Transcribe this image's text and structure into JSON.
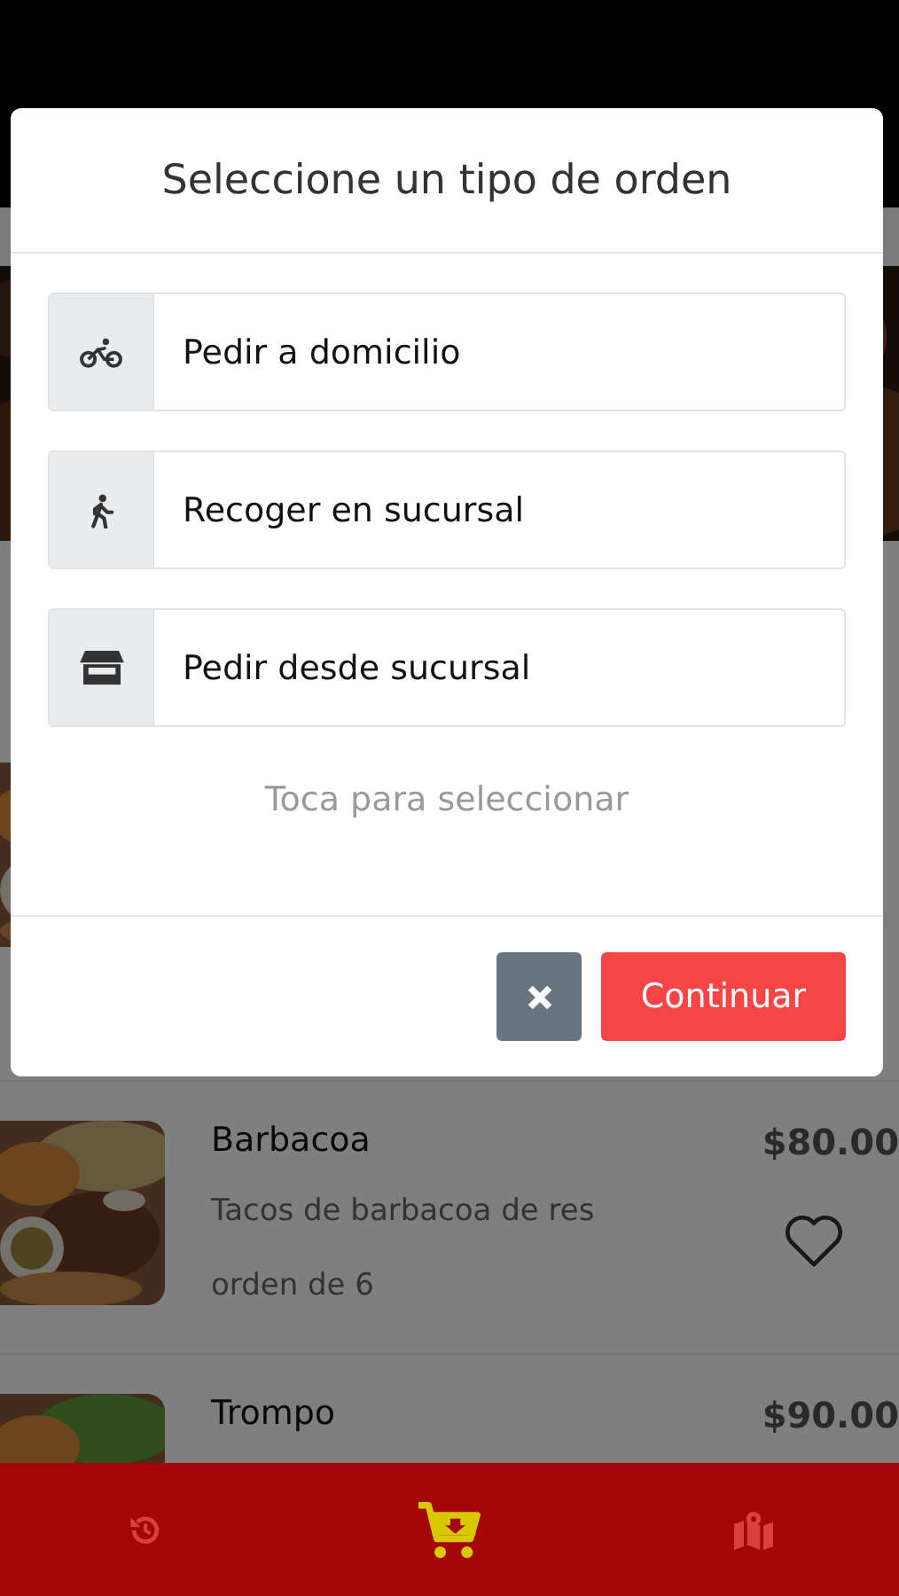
{
  "dialog": {
    "title": "Seleccione un tipo de orden",
    "options": [
      {
        "kind": "delivery",
        "label": "Pedir a domicilio"
      },
      {
        "kind": "pickup",
        "label": "Recoger en sucursal"
      },
      {
        "kind": "store",
        "label": "Pedir desde sucursal"
      }
    ],
    "hint": "Toca para seleccionar",
    "confirm": "Continuar"
  },
  "menu": [
    {
      "kind": "picture"
    },
    {
      "name": "Barbacoa",
      "description": "Tacos de barbacoa de res orden de 6",
      "price": "$80.00"
    },
    {
      "name": "Trompo",
      "price": "$90.00"
    }
  ],
  "nav": [
    {
      "kind": "history",
      "selected": false
    },
    {
      "kind": "cart",
      "selected": true
    },
    {
      "kind": "map",
      "selected": false
    }
  ]
}
